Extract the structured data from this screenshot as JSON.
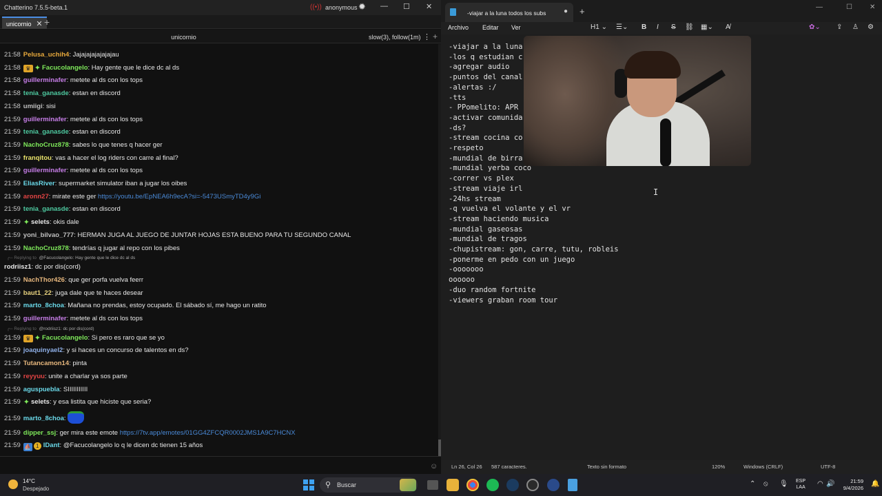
{
  "chatterino": {
    "window_title": "Chatterino 7.5.5-beta.1",
    "account": "anonymous",
    "tab_label": "unicornio",
    "channel_name": "unicornio",
    "channel_modes": "slow(3), follow(1m)",
    "messages": [
      {
        "time": "21:58",
        "nick": "Pelusa_uchih4",
        "color": "#e8a93c",
        "text": "Jajajajajajajajau"
      },
      {
        "time": "21:58",
        "nick": "Facucolangelo",
        "color": "#7ee85a",
        "badges": [
          "crown",
          "spark"
        ],
        "text": "Hay gente que le dice dc al ds"
      },
      {
        "time": "21:58",
        "nick": "guillerminafer",
        "color": "#c77ee8",
        "text": "metete al ds con los tops"
      },
      {
        "time": "21:58",
        "nick": "tenia_ganasde",
        "color": "#4ec9a0",
        "text": "estan en discord"
      },
      {
        "time": "21:58",
        "nick": "umiigi",
        "color": "#bfbfbf",
        "text": "sisi"
      },
      {
        "time": "21:59",
        "nick": "guillerminafer",
        "color": "#c77ee8",
        "text": "metete al ds con los tops"
      },
      {
        "time": "21:59",
        "nick": "tenia_ganasde",
        "color": "#4ec9a0",
        "text": "estan en discord"
      },
      {
        "time": "21:59",
        "nick": "NachoCruz878",
        "color": "#7ee85a",
        "text": "sabes lo que tenes q hacer ger"
      },
      {
        "time": "21:59",
        "nick": "franqitou",
        "color": "#e8e26a",
        "text": "vas a hacer el log riders con carre al final?"
      },
      {
        "time": "21:59",
        "nick": "guillerminafer",
        "color": "#c77ee8",
        "text": "metete al ds con los tops"
      },
      {
        "time": "21:59",
        "nick": "EliasRiver",
        "color": "#6ad8e8",
        "text": "supermarket simulator iban a jugar los oibes"
      },
      {
        "time": "21:59",
        "nick": "aronn27",
        "color": "#e24444",
        "text": "mirate este ger ",
        "link": "https://youtu.be/EpNEA6h9ecA?si=-5473USmyTD4y9Gi"
      },
      {
        "time": "21:59",
        "nick": "tenia_ganasde",
        "color": "#4ec9a0",
        "text": "estan en discord"
      },
      {
        "time": "21:59",
        "nick": "selets",
        "color": "#e8e8e8",
        "badges": [
          "spark"
        ],
        "text": "okis dale"
      },
      {
        "time": "21:59",
        "nick": "yoni_bilvao_777",
        "color": "#bfbfbf",
        "text": "HERMAN JUGA AL JUEGO DE JUNTAR HOJAS ESTA BUENO PARA TU SEGUNDO CANAL"
      },
      {
        "time": "21:59",
        "nick": "NachoCruz878",
        "color": "#7ee85a",
        "text": "tendrías q jugar al repo con los pibes"
      },
      {
        "reply_to": "@Facucolangelo:",
        "reply_text": "Hay gente que le dice dc al ds",
        "nick": "rodriisz1",
        "color": "#e8e8e8",
        "text": "dc por dis(cord)"
      },
      {
        "time": "21:59",
        "nick": "NachThor426",
        "color": "#e8b87e",
        "text": "que ger porfa vuelva feerr"
      },
      {
        "time": "21:59",
        "nick": "baut1_22",
        "color": "#e8d27e",
        "text": "juga dale que te haces desear"
      },
      {
        "time": "21:59",
        "nick": "marto_8choa",
        "color": "#6ad8e8",
        "text": "Mañana no prendas, estoy ocupado. El sábado sí, me hago un ratito"
      },
      {
        "time": "21:59",
        "nick": "guillerminafer",
        "color": "#c77ee8",
        "text": "metete al ds con los tops"
      },
      {
        "reply_to": "@rodriisz1:",
        "reply_text": "dc por dis(cord)",
        "time": "21:59",
        "nick": "Facucolangelo",
        "color": "#7ee85a",
        "badges": [
          "crown",
          "spark"
        ],
        "text": "Si pero es raro que se yo"
      },
      {
        "time": "21:59",
        "nick": "joaquinyael2",
        "color": "#8fb0e8",
        "text": "y si haces un concurso de talentos en ds?"
      },
      {
        "time": "21:59",
        "nick": "Tutancamon14",
        "color": "#e8b87e",
        "text": "pinta"
      },
      {
        "time": "21:59",
        "nick": "reyyuu",
        "color": "#e24444",
        "text": "unite a charlar ya sos parte"
      },
      {
        "time": "21:59",
        "nick": "aguspuebla",
        "color": "#6ad8e8",
        "text": "SIIIIIIIIIII"
      },
      {
        "time": "21:59",
        "nick": "selets",
        "color": "#e8e8e8",
        "badges": [
          "spark"
        ],
        "text": "y esa listita que hiciste que seria?"
      },
      {
        "time": "21:59",
        "nick": "marto_8choa",
        "color": "#6ad8e8",
        "text": "",
        "emote": true
      },
      {
        "time": "21:59",
        "nick": "dipper_ssj",
        "color": "#7ee85a",
        "text": "ger mira este emote ",
        "link": "https://7tv.app/emotes/01GG4ZFCQR0002JMS1A9C7HCNX"
      },
      {
        "time": "21:59",
        "nick": "IDant",
        "color": "#6ad8e8",
        "badges": [
          "blue",
          "gold"
        ],
        "text": "@Facucolangelo lo q le dicen dc tienen 15 años"
      }
    ]
  },
  "notepad": {
    "tab_title": "-viajar a la luna todos los subs",
    "menu": [
      "Archivo",
      "Editar",
      "Ver"
    ],
    "heading_select": "H1",
    "lines": [
      "-viajar a la luna",
      "-los q estudian c",
      "-agregar audio",
      "-puntos del canal",
      "-alertas :/",
      "-tts",
      "- PPomelito: APR",
      "-activar comunida",
      "-ds?",
      "-stream cocina co",
      "-respeto",
      "-mundial de birra",
      "-mundial yerba coco",
      "-correr vs plex",
      "-stream viaje irl",
      "-24hs stream",
      "-q vuelva el volante y el vr",
      "-stream haciendo musica",
      "-mundial gaseosas",
      "-mundial de tragos",
      "-chupistream: gon, carre, tutu, robleis",
      "-ponerme en pedo con un juego",
      "-ooooooo",
      "oooooo",
      "-duo random fortnite",
      "-viewers graban room tour"
    ],
    "status": {
      "position": "Ln 26, Col 26",
      "chars": "587 caracteres.",
      "format": "Texto sin formato",
      "zoom": "120%",
      "eol": "Windows (CRLF)",
      "encoding": "UTF-8"
    }
  },
  "taskbar": {
    "temperature": "14°C",
    "condition": "Despejado",
    "search_placeholder": "Buscar",
    "lang_top": "ESP",
    "lang_bottom": "LAA",
    "time": "21:59",
    "date": "9/4/2026"
  }
}
